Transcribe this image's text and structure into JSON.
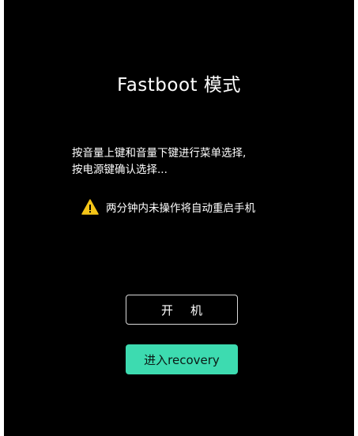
{
  "screen": {
    "title": "Fastboot 模式",
    "instruction_line1": "按音量上键和音量下键进行菜单选择,",
    "instruction_line2": "按电源键确认选择...",
    "warning_text": "两分钟内未操作将自动重启手机",
    "warning_icon": "warning-triangle-icon",
    "warning_color": "#f5c518",
    "accent_color": "#3ddbb0"
  },
  "buttons": {
    "boot_label": "开机",
    "recovery_label": "进入recovery"
  }
}
